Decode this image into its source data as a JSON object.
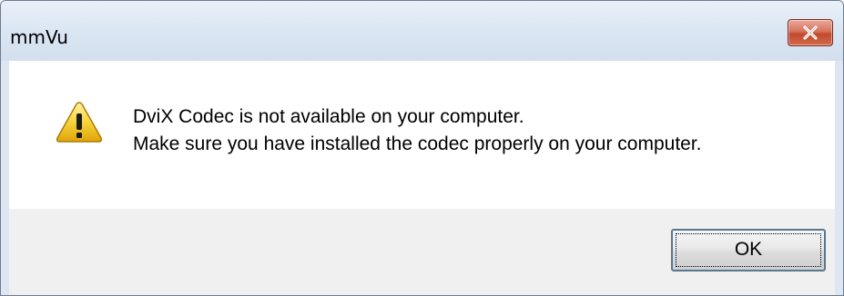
{
  "window": {
    "title": "mmVu"
  },
  "dialog": {
    "icon": "warning-icon",
    "message_line1": "DviX Codec is not available on your computer.",
    "message_line2": "Make sure you have installed the codec properly on your computer.",
    "ok_label": "OK"
  },
  "colors": {
    "titlebar": "#dbe6f3",
    "close_button": "#c2492d",
    "content_bg": "#ffffff",
    "footer_bg": "#f0f0f0",
    "warning_yellow": "#f4c20d"
  }
}
